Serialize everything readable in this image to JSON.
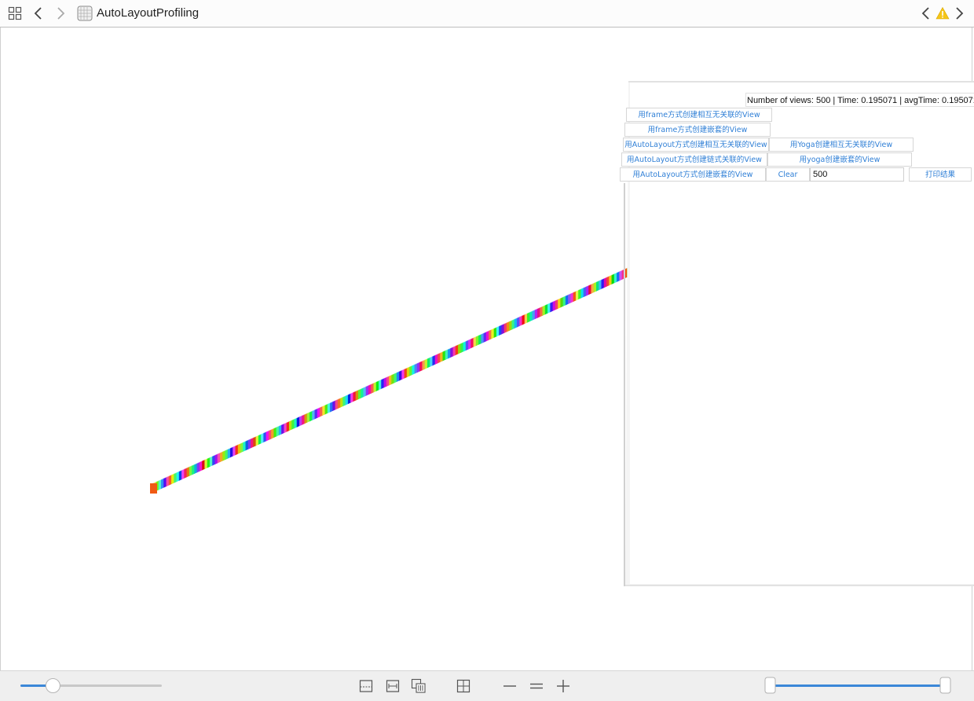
{
  "toolbar": {
    "grid_icon": "grid-icon",
    "back_icon": "chevron-left-icon",
    "forward_icon": "chevron-right-icon",
    "app_icon": "xcode-view-icon",
    "title": "AutoLayoutProfiling",
    "issue_prev_icon": "chevron-left-icon",
    "warning_icon": "warning-icon",
    "issue_next_icon": "chevron-right-icon",
    "warning_color": "#f5c518"
  },
  "device": {
    "stats": "Number of views: 500 | Time: 0.195071 | avgTime: 0.195071",
    "buttons": {
      "frame_unrelated": "用frame方式创建相互无关联的View",
      "frame_nested": "用frame方式创建嵌套的View",
      "autolayout_unrelated": "用AutoLayout方式创建相互无关联的View",
      "yoga_unrelated": "用Yoga创建相互无关联的View",
      "autolayout_chain": "用AutoLayout方式创建链式关联的View",
      "yoga_nested": "用yoga创建嵌套的View",
      "autolayout_nested": "用AutoLayout方式创建嵌套的View",
      "clear": "Clear",
      "print_result": "打印结果"
    },
    "count_input_value": "500",
    "accent_color": "#2f7fd6"
  },
  "bottom_bar": {
    "spacing_slider_value": 0.23,
    "range_slider_min": 0.0,
    "range_slider_max": 1.0,
    "icons": [
      "show-clipped-content-icon",
      "show-frames-icon",
      "show-constraints-icon",
      "orient-icon",
      "zoom-out-icon",
      "actual-size-icon",
      "zoom-in-icon"
    ]
  }
}
